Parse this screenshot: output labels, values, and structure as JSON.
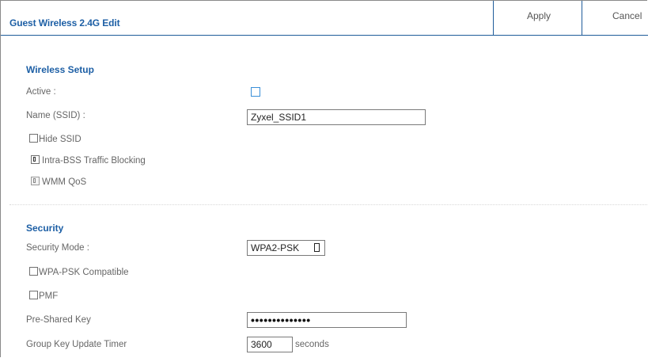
{
  "header": {
    "title": "Guest Wireless 2.4G Edit",
    "apply_label": "Apply",
    "cancel_label": "Cancel"
  },
  "wireless_setup": {
    "section_title": "Wireless Setup",
    "active_label": "Active :",
    "active_checked": false,
    "name_label": "Name (SSID) :",
    "name_value": "Zyxel_SSID1",
    "hide_ssid_label": "Hide SSID",
    "hide_ssid_checked": false,
    "intra_bss_label": "Intra-BSS Traffic Blocking",
    "intra_bss_checked": true,
    "wmm_qos_label": "WMM QoS",
    "wmm_qos_checked": true,
    "wmm_qos_disabled": true
  },
  "security": {
    "section_title": "Security",
    "mode_label": "Security Mode :",
    "mode_value": "WPA2-PSK",
    "wpa_psk_compatible_label": "WPA-PSK Compatible",
    "wpa_psk_compatible_checked": false,
    "pmf_label": "PMF",
    "pmf_checked": false,
    "psk_label": "Pre-Shared Key",
    "psk_masked": "••••••••••••••",
    "group_key_label": "Group Key Update Timer",
    "group_key_value": "3600",
    "group_key_unit": "seconds"
  },
  "colors": {
    "accent": "#1d5fa5",
    "border": "#1f5c9a",
    "text": "#666666"
  }
}
